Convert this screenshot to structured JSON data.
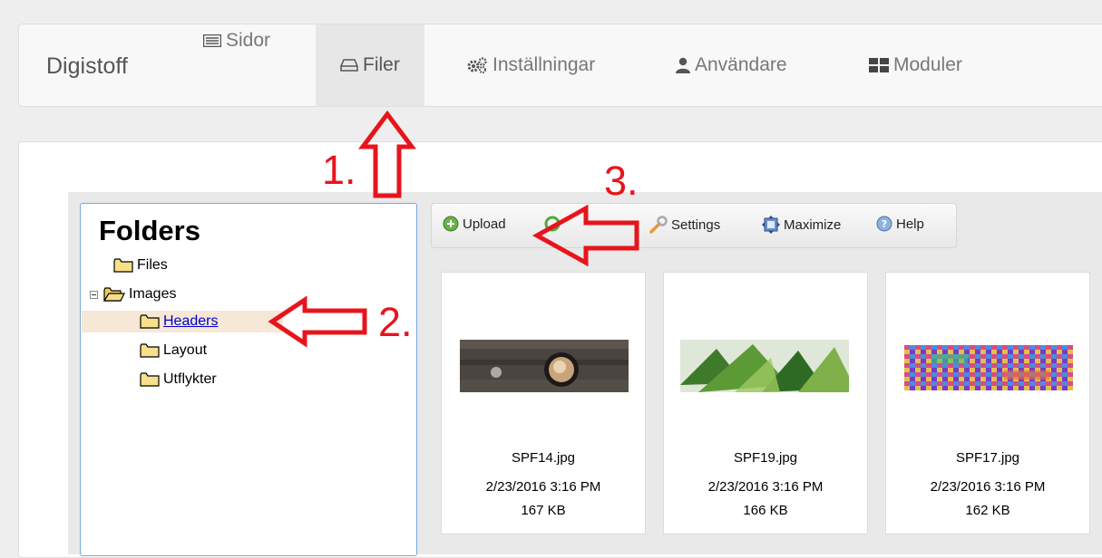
{
  "navbar": {
    "brand": "Digistoff",
    "items": [
      {
        "label": "Sidor",
        "icon": "list-icon",
        "active": false
      },
      {
        "label": "Filer",
        "icon": "hdd-icon",
        "active": true
      },
      {
        "label": "Inställningar",
        "icon": "cogs-icon",
        "active": false
      },
      {
        "label": "Användare",
        "icon": "user-icon",
        "active": false
      },
      {
        "label": "Moduler",
        "icon": "grid-icon",
        "active": false
      }
    ]
  },
  "folders": {
    "title": "Folders",
    "tree": [
      {
        "label": "Files",
        "level": 0
      },
      {
        "label": "Images",
        "level": 0,
        "expanded": true
      },
      {
        "label": "Headers",
        "level": 1,
        "selected": true
      },
      {
        "label": "Layout",
        "level": 1
      },
      {
        "label": "Utflykter",
        "level": 1
      }
    ]
  },
  "toolbar": {
    "upload": "Upload",
    "settings": "Settings",
    "maximize": "Maximize",
    "help": "Help"
  },
  "files": [
    {
      "name": "SPF14.jpg",
      "date": "2/23/2016 3:16 PM",
      "size": "167 KB"
    },
    {
      "name": "SPF19.jpg",
      "date": "2/23/2016 3:16 PM",
      "size": "166 KB"
    },
    {
      "name": "SPF17.jpg",
      "date": "2/23/2016 3:16 PM",
      "size": "162 KB"
    }
  ],
  "annotations": {
    "step1": "1.",
    "step2": "2.",
    "step3": "3."
  },
  "colors": {
    "annotation": "#e8141b",
    "active_tab_bg": "#e7e7e7",
    "selected_folder_bg": "#f6e7d6",
    "link": "#0000cc"
  }
}
